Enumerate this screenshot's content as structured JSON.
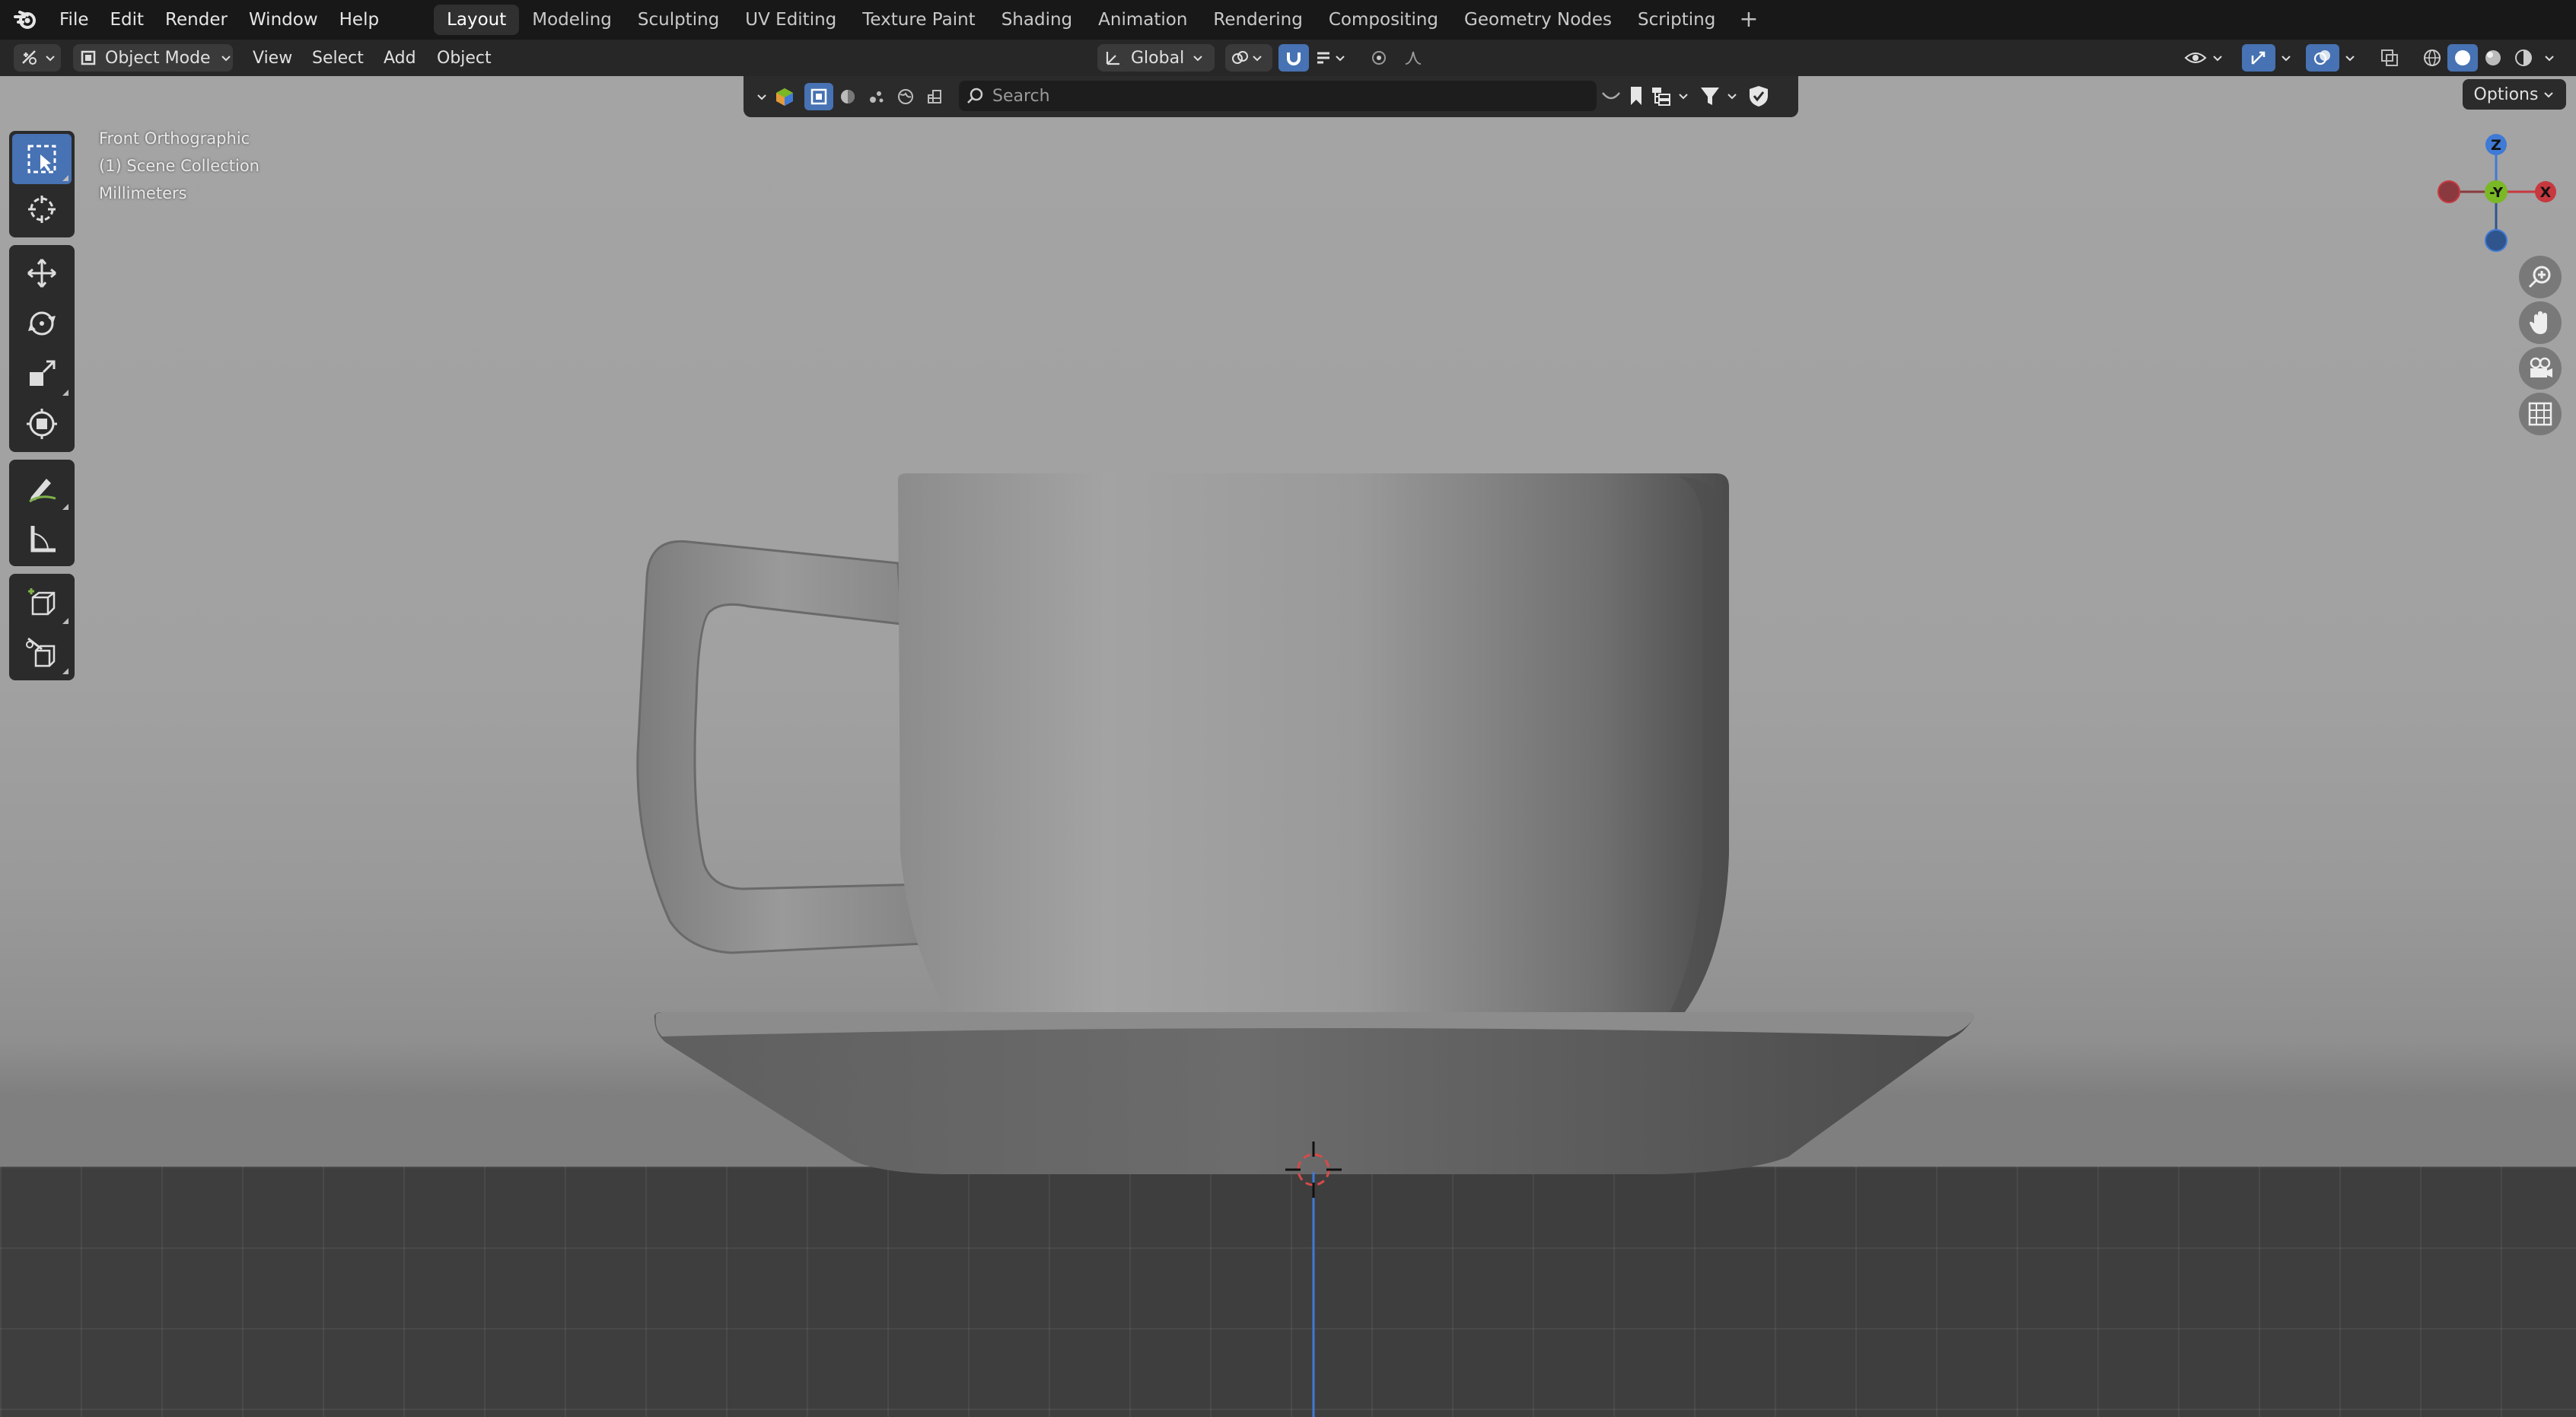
{
  "menu": [
    "File",
    "Edit",
    "Render",
    "Window",
    "Help"
  ],
  "workspaces": [
    {
      "label": "Layout",
      "active": true
    },
    {
      "label": "Modeling",
      "active": false
    },
    {
      "label": "Sculpting",
      "active": false
    },
    {
      "label": "UV Editing",
      "active": false
    },
    {
      "label": "Texture Paint",
      "active": false
    },
    {
      "label": "Shading",
      "active": false
    },
    {
      "label": "Animation",
      "active": false
    },
    {
      "label": "Rendering",
      "active": false
    },
    {
      "label": "Compositing",
      "active": false
    },
    {
      "label": "Geometry Nodes",
      "active": false
    },
    {
      "label": "Scripting",
      "active": false
    }
  ],
  "header": {
    "mode": "Object Mode",
    "view_menu": [
      "View",
      "Select",
      "Add",
      "Object"
    ],
    "transform_orientation": "Global"
  },
  "filter": {
    "search_placeholder": "Search"
  },
  "viewport": {
    "view_name": "Front Orthographic",
    "collection": "(1) Scene Collection",
    "units": "Millimeters",
    "options_label": "Options"
  },
  "gizmo": {
    "z": "Z",
    "y": "-Y",
    "x": "X"
  },
  "colors": {
    "accent": "#4772b3",
    "axis_x": "#c8383f",
    "axis_y": "#7ab825",
    "axis_z": "#3e7ad6"
  },
  "tools": [
    "select-box-icon",
    "cursor-icon",
    "move-icon",
    "rotate-icon",
    "scale-icon",
    "transform-icon",
    "annotate-icon",
    "measure-icon",
    "add-cube-icon",
    "knife-cube-icon"
  ]
}
